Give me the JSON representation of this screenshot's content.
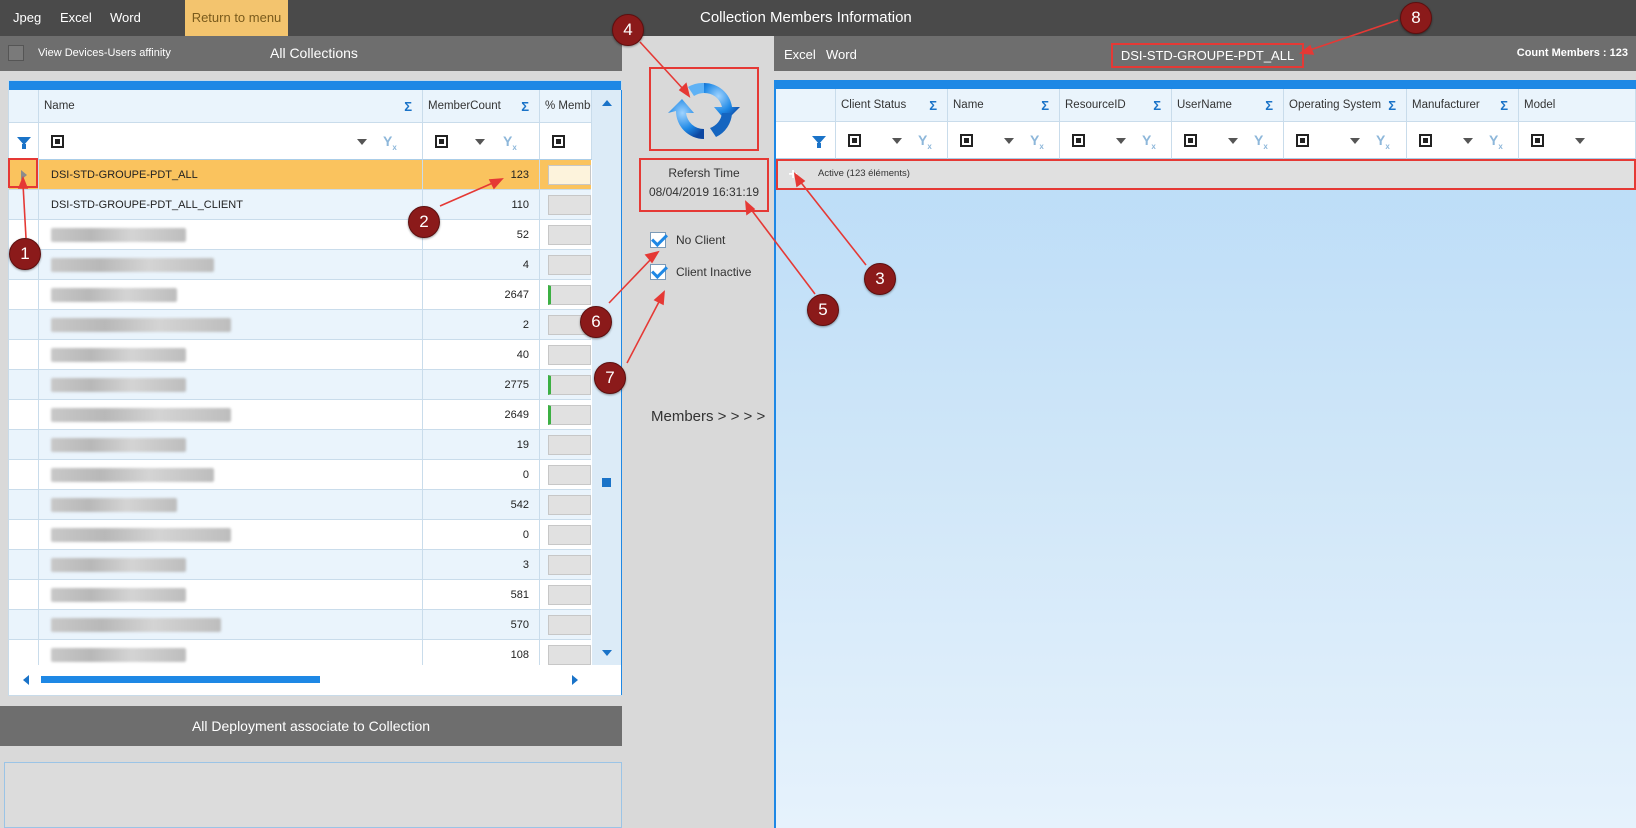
{
  "topbar": {
    "menu": [
      "Jpeg",
      "Excel",
      "Word"
    ],
    "return_label": "Return to menu",
    "title": "Collection Members Information"
  },
  "left_panel": {
    "affinity_label": "View Devices-Users affinity",
    "title": "All Collections",
    "columns": [
      "Name",
      "MemberCount",
      "% Member"
    ],
    "rows": [
      {
        "name": "DSI-STD-GROUPE-PDT_ALL",
        "count": "123",
        "selected": true
      },
      {
        "name": "DSI-STD-GROUPE-PDT_ALL_CLIENT",
        "count": "110"
      },
      {
        "name": "",
        "count": "52"
      },
      {
        "name": "",
        "count": "4"
      },
      {
        "name": "",
        "count": "2647",
        "green": true
      },
      {
        "name": "",
        "count": "2"
      },
      {
        "name": "",
        "count": "40"
      },
      {
        "name": "",
        "count": "2775",
        "green": true
      },
      {
        "name": "",
        "count": "2649",
        "green": true
      },
      {
        "name": "",
        "count": "19"
      },
      {
        "name": "",
        "count": "0"
      },
      {
        "name": "",
        "count": "542"
      },
      {
        "name": "",
        "count": "0"
      },
      {
        "name": "",
        "count": "3"
      },
      {
        "name": "",
        "count": "581"
      },
      {
        "name": "",
        "count": "570"
      },
      {
        "name": "",
        "count": "108"
      }
    ]
  },
  "deploy": {
    "title": "All Deployment associate to Collection"
  },
  "middle": {
    "refresh_title": "Refersh Time",
    "refresh_time": "08/04/2019 16:31:19",
    "no_client": "No Client",
    "client_inactive": "Client Inactive",
    "members_label": "Members > > > >"
  },
  "right_panel": {
    "menu": [
      "Excel",
      "Word"
    ],
    "collection_name": "DSI-STD-GROUPE-PDT_ALL",
    "count_label": "Count Members : 123",
    "columns": [
      "Client Status",
      "Name",
      "ResourceID",
      "UserName",
      "Operating System",
      "Manufacturer",
      "Model"
    ],
    "group_label": "Active (123 éléments)"
  },
  "annotations": [
    "1",
    "2",
    "3",
    "4",
    "5",
    "6",
    "7",
    "8"
  ],
  "colors": {
    "accent": "#1e88e5",
    "selected_row": "#fac35e",
    "annotation": "#8b1a1a",
    "highlight": "#e53935"
  }
}
